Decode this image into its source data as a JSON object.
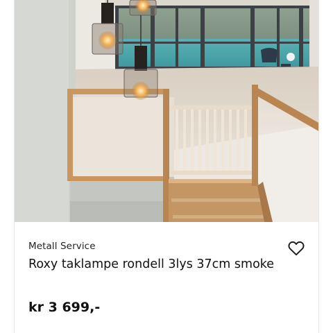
{
  "product": {
    "image_alt": "Roxy taklampe rondell over trapp med utsikt mot fjord",
    "seller": "Metall Service",
    "title": "Roxy taklampe rondell 3lys 37cm smoke",
    "price": "kr 3 699,-"
  },
  "icons": {
    "favorite": "heart-outline-icon"
  },
  "colors": {
    "text": "#111111",
    "background": "#ffffff"
  }
}
